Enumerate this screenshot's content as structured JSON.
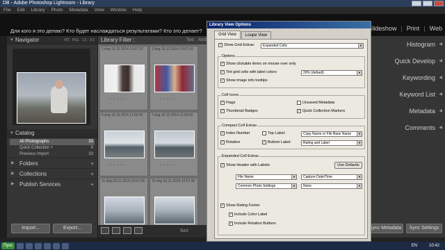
{
  "window": {
    "title": "DB - Adobe Photoshop Lightroom - Library"
  },
  "menu": [
    "File",
    "Edit",
    "Library",
    "Photo",
    "Metadata",
    "View",
    "Window",
    "Help"
  ],
  "identity_plate": "Для кого я это делаю? Кто будет наслаждаться результатами? Кто это делает?",
  "modules": [
    "Slideshow",
    "Print",
    "Web"
  ],
  "left_panel": {
    "navigator": {
      "title": "Navigator",
      "zooms": [
        "FIT",
        "FILL",
        "1:1",
        "3:1"
      ]
    },
    "catalog": {
      "title": "Catalog",
      "rows": [
        {
          "label": "All Photographs",
          "count": "33"
        },
        {
          "label": "Quick Collection +",
          "count": "0"
        },
        {
          "label": "Previous Import",
          "count": "33"
        }
      ]
    },
    "sections": [
      "Folders",
      "Collections",
      "Publish Services"
    ],
    "buttons": {
      "import": "Import...",
      "export": "Export..."
    }
  },
  "grid": {
    "filter_label": "Library Filter :",
    "filter_tabs": [
      "Text",
      "Attrib"
    ],
    "rows": [
      [
        {
          "name": "1.dng",
          "date": "19.10.2014 13:07:10"
        },
        {
          "name": "2.dng",
          "date": "19.10.2014 13:07:10"
        }
      ],
      [
        {
          "name": "6.dng",
          "date": "19.10.2014 11:03:43"
        },
        {
          "name": "7.dng",
          "date": "19.10.2014 11:03:43"
        }
      ],
      [
        {
          "name": "11.dng",
          "date": "02.11.2014 12:57:30"
        },
        {
          "name": "12.dng",
          "date": "02.11.2014 12:57:30"
        }
      ]
    ],
    "sort_label": "Sort:"
  },
  "right_panel": {
    "items": [
      "Histogram",
      "Quick Develop",
      "Keywording",
      "Keyword List",
      "Metadata",
      "Comments"
    ],
    "buttons": {
      "sync_metadata": "Sync Metadata",
      "sync_settings": "Sync Settings"
    }
  },
  "dialog": {
    "title": "Library View Options",
    "tabs": [
      "Grid View",
      "Loupe View"
    ],
    "show_grid_extras": {
      "label": "Show Grid Extras:",
      "value": "Expanded Cells"
    },
    "options": {
      "title": "Options",
      "show_clickable": "Show clickable items on mouse over only",
      "tint_label": "Tint grid cells with label colors",
      "tint_value": "20% (default)",
      "show_tooltips": "Show image info tooltips"
    },
    "cell_icons": {
      "title": "Cell Icons",
      "flags": "Flags",
      "unsaved_metadata": "Unsaved Metadata",
      "thumbnail_badges": "Thumbnail Badges",
      "quick_collection": "Quick Collection Markers"
    },
    "compact": {
      "title": "Compact Cell Extras",
      "index_number": "Index Number",
      "top_label": "Top Label:",
      "top_value": "Copy Name or File Base Name",
      "rotation": "Rotation",
      "bottom_label": "Bottom Label:",
      "bottom_value": "Rating and Label"
    },
    "expanded": {
      "title": "Expanded Cell Extras",
      "show_header": "Show Header with Labels:",
      "use_defaults": "Use Defaults",
      "field1": "File Name",
      "field2": "Capture Date/Time",
      "field3": "Common Photo Settings",
      "field4": "None",
      "show_rating_footer": "Show Rating Footer",
      "include_color_label": "Include Color Label",
      "include_rotation": "Include Rotation Buttons"
    }
  },
  "taskbar": {
    "start": "Пуск",
    "lang": "EN",
    "time": "10:42"
  }
}
